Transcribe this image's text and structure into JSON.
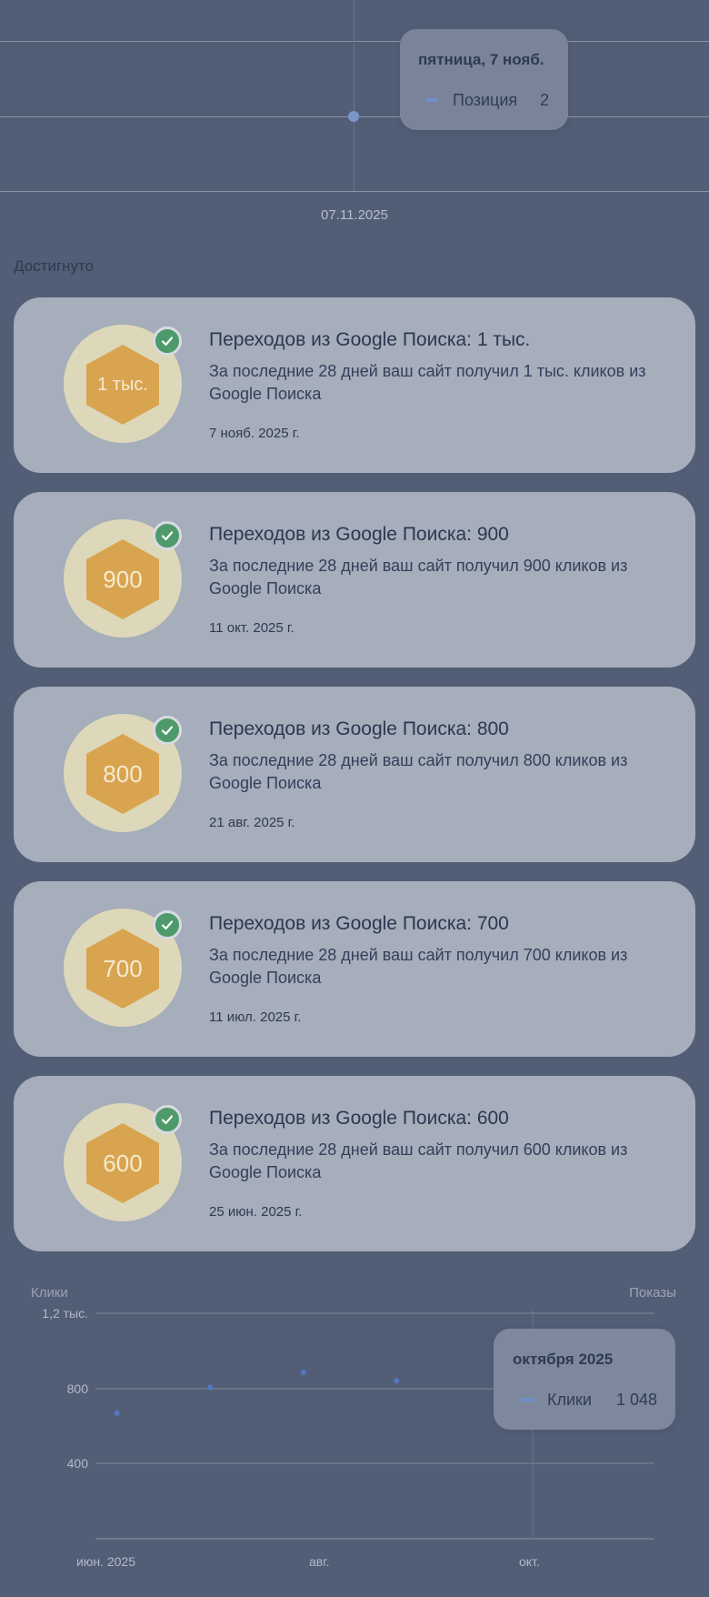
{
  "top_chart": {
    "tooltip": {
      "title": "пятница, 7 нояб.",
      "series_label": "Позиция",
      "value": "2"
    },
    "x_label": "07.11.2025",
    "colors": {
      "point": "#7b94c9",
      "series_swatch": "#6f8fc9"
    }
  },
  "section_title": "Достигнуто",
  "achievements": [
    {
      "badge": "1 тыс.",
      "title": "Переходов из Google Поиска: 1 тыс.",
      "description": "За последние 28 дней ваш сайт получил 1 тыс. кликов из Google Поиска",
      "date": "7 нояб. 2025 г.",
      "icon": "check-icon"
    },
    {
      "badge": "900",
      "title": "Переходов из Google Поиска: 900",
      "description": "За последние 28 дней ваш сайт получил 900 кликов из Google Поиска",
      "date": "11 окт. 2025 г.",
      "icon": "check-icon"
    },
    {
      "badge": "800",
      "title": "Переходов из Google Поиска: 800",
      "description": "За последние 28 дней ваш сайт получил 800 кликов из Google Поиска",
      "date": "21 авг. 2025 г.",
      "icon": "check-icon"
    },
    {
      "badge": "700",
      "title": "Переходов из Google Поиска: 700",
      "description": "За последние 28 дней ваш сайт получил 700 кликов из Google Поиска",
      "date": "11 июл. 2025 г.",
      "icon": "check-icon"
    },
    {
      "badge": "600",
      "title": "Переходов из Google Поиска: 600",
      "description": "За последние 28 дней ваш сайт получил 600 кликов из Google Поиска",
      "date": "25 июн. 2025 г.",
      "icon": "check-icon"
    }
  ],
  "bottom_chart": {
    "left_axis_title": "Клики",
    "right_axis_title": "Показы",
    "y_ticks": [
      "1,2 тыс.",
      "800",
      "400"
    ],
    "x_ticks": [
      "июн. 2025",
      "авг.",
      "окт."
    ],
    "tooltip": {
      "title": "октября 2025",
      "series_label": "Клики",
      "value": "1 048"
    },
    "colors": {
      "points": "#5577c6",
      "highlight": "#a9bde6"
    }
  },
  "chart_data": {
    "type": "scatter",
    "xlabel": "",
    "ylabel": "Клики",
    "ylim": [
      0,
      1200
    ],
    "series": [
      {
        "name": "Клики",
        "x": [
          "2025-06-07",
          "2025-07-03",
          "2025-07-29",
          "2025-08-24",
          "2025-09-28"
        ],
        "y": [
          668,
          805,
          885,
          840,
          1048
        ]
      }
    ]
  }
}
